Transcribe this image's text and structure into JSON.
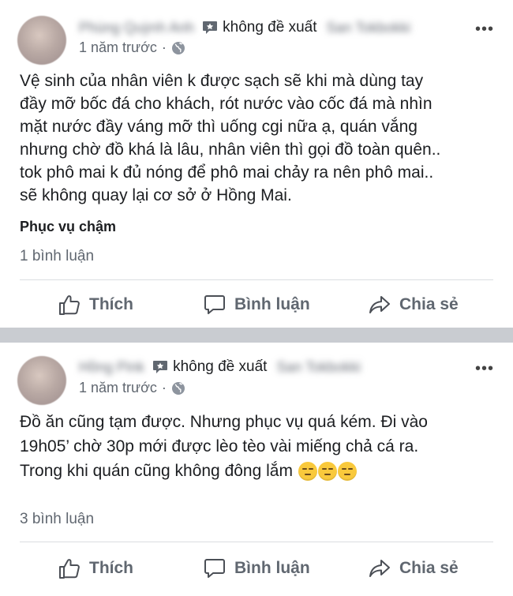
{
  "posts": [
    {
      "author": "Phùng Quỳnh Anh",
      "recommendation": "không đề xuất",
      "page": "San Tokbokki",
      "time": "1 năm trước",
      "text": "Vệ sinh của nhân viên k được sạch sẽ khi mà dùng tay\nđầy mỡ bốc đá cho khách, rót nước vào cốc đá mà nhìn\nmặt nước đầy váng mỡ thì uống cgi nữa ạ, quán vắng\nnhưng chờ đồ khá là lâu, nhân viên thì gọi đồ toàn quên..\ntok phô mai k đủ nóng để phô mai chảy ra nên phô mai..\nsẽ không quay lại cơ sở ở Hồng Mai.",
      "tag": "Phục vụ chậm",
      "comments": "1 bình luận"
    },
    {
      "author": "Hồng Pink",
      "recommendation": "không đề xuất",
      "page": "San Tokbokki",
      "time": "1 năm trước",
      "text": "Đồ ăn cũng tạm được. Nhưng phục vụ quá kém. Đi vào\n19h05’ chờ 30p mới được lèo tèo vài miếng chả cá ra.\nTrong khi quán cũng không đông lắm",
      "comments": "3 bình luận"
    }
  ],
  "actions": {
    "like": "Thích",
    "comment": "Bình luận",
    "share": "Chia sẻ"
  },
  "more_glyph": "•••",
  "meta_separator": "·",
  "colors": {
    "background": "#c9ccd1",
    "card": "#ffffff",
    "text": "#1c1e21",
    "secondary": "#606770",
    "divider": "#dadde1"
  },
  "icons": [
    "recommendation-badge-icon",
    "globe-icon",
    "more-options-icon",
    "like-icon",
    "comment-icon",
    "share-icon",
    "unamused-emoji-icon"
  ]
}
